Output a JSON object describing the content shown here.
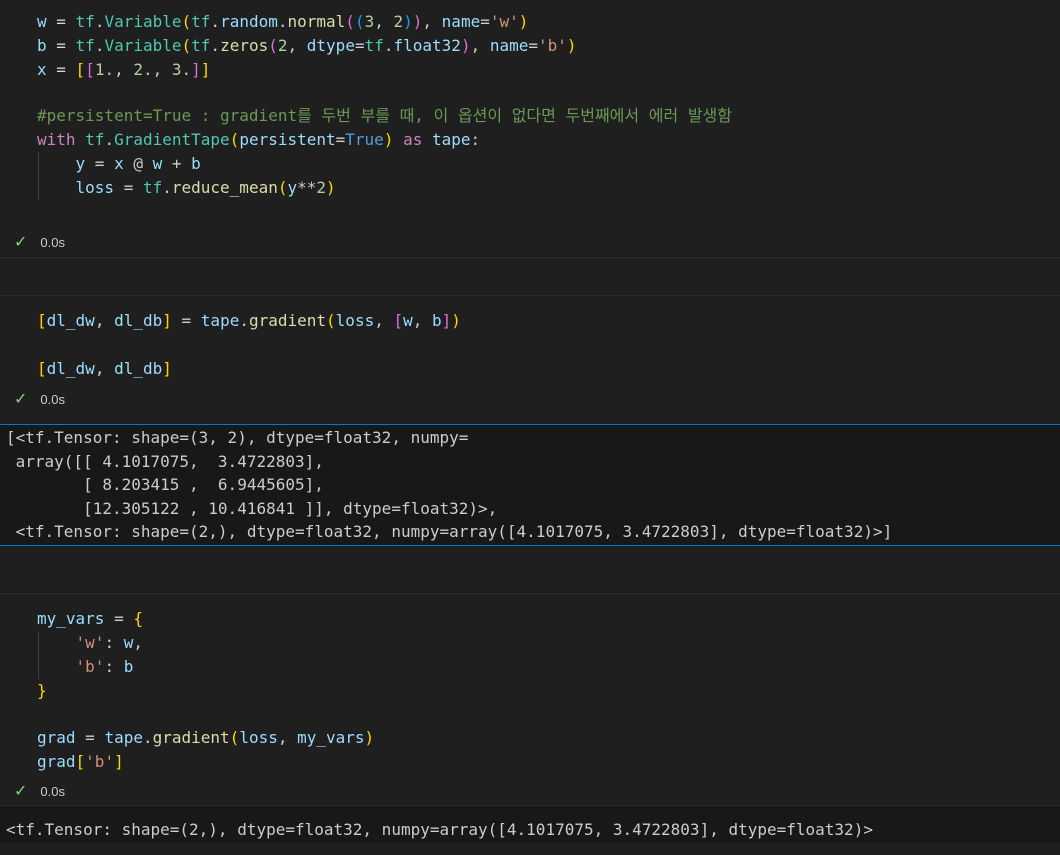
{
  "cells": [
    {
      "status": "0.0s",
      "lines": [
        "w = tf.Variable(tf.random.normal((3, 2)), name='w')",
        "b = tf.Variable(tf.zeros(2, dtype=tf.float32), name='b')",
        "x = [[1., 2., 3.]]",
        "",
        "#persistent=True : gradient를 두번 부를 때, 이 옵션이 없다면 두번째에서 에러 발생함",
        "with tf.GradientTape(persistent=True) as tape:",
        "    y = x @ w + b",
        "    loss = tf.reduce_mean(y**2)"
      ]
    },
    {
      "status": "0.0s",
      "lines": [
        "[dl_dw, dl_db] = tape.gradient(loss, [w, b])",
        "",
        "[dl_dw, dl_db]"
      ],
      "output": [
        "[<tf.Tensor: shape=(3, 2), dtype=float32, numpy=",
        " array([[ 4.1017075,  3.4722803],",
        "        [ 8.203415 ,  6.9445605],",
        "        [12.305122 , 10.416841 ]], dtype=float32)>,",
        " <tf.Tensor: shape=(2,), dtype=float32, numpy=array([4.1017075, 3.4722803], dtype=float32)>]"
      ]
    },
    {
      "status": "0.0s",
      "lines": [
        "my_vars = {",
        "    'w': w,",
        "    'b': b",
        "}",
        "",
        "grad = tape.gradient(loss, my_vars)",
        "grad['b']"
      ],
      "output": [
        "<tf.Tensor: shape=(2,), dtype=float32, numpy=array([4.1017075, 3.4722803], dtype=float32)>"
      ]
    }
  ]
}
